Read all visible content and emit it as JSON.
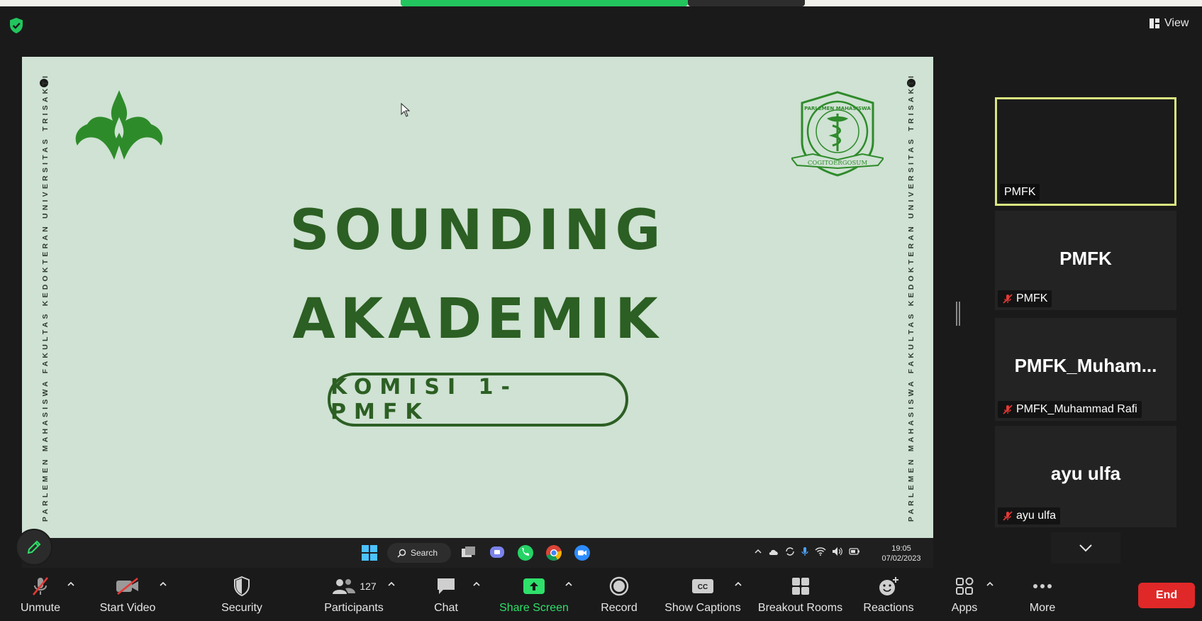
{
  "view": {
    "label": "View"
  },
  "slide": {
    "title_line1": "SOUNDING",
    "title_line2": "AKADEMIK",
    "pill_text": "KOMISI 1- PMFK",
    "side_text": "PARLEMEN MAHASISWA FAKULTAS KEDOKTERAN UNIVERSITAS TRISAKTI",
    "seal_top_text": "PARLEMEN MAHASISWA",
    "seal_motto": "COGITOERGOSUM"
  },
  "taskbar": {
    "search_label": "Search",
    "time": "19:05",
    "date": "07/02/2023"
  },
  "participants": [
    {
      "display": "",
      "name": "PMFK",
      "muted": false,
      "active": true
    },
    {
      "display": "PMFK",
      "name": "PMFK",
      "muted": true,
      "active": false
    },
    {
      "display": "PMFK_Muham...",
      "name": "PMFK_Muhammad Rafi",
      "muted": true,
      "active": false
    },
    {
      "display": "ayu ulfa",
      "name": "ayu ulfa",
      "muted": true,
      "active": false
    }
  ],
  "toolbar": {
    "unmute": "Unmute",
    "start_video": "Start Video",
    "security": "Security",
    "participants": "Participants",
    "participants_count": "127",
    "chat": "Chat",
    "share_screen": "Share Screen",
    "record": "Record",
    "show_captions": "Show Captions",
    "breakout_rooms": "Breakout Rooms",
    "reactions": "Reactions",
    "apps": "Apps",
    "more": "More",
    "end": "End"
  },
  "colors": {
    "slide_bg": "#cfe2d3",
    "slide_green": "#2c5f23",
    "share_green": "#2ee06a",
    "end_red": "#e02828",
    "active_border": "#d9e57f"
  }
}
